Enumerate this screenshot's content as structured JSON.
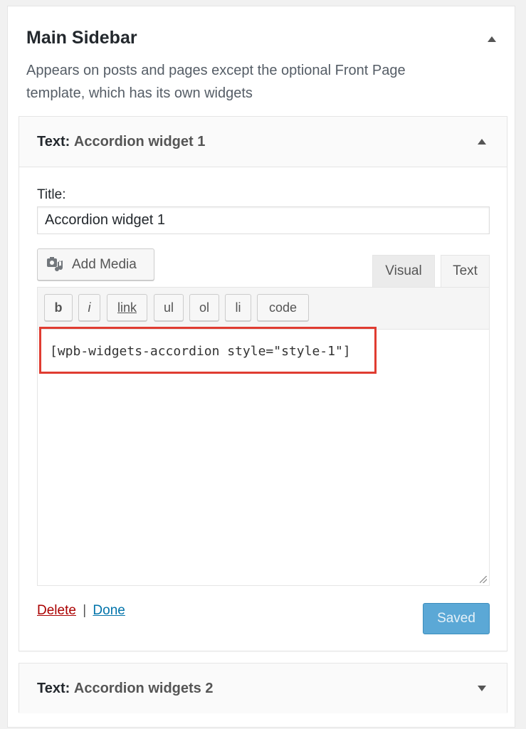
{
  "sidebar": {
    "title": "Main Sidebar",
    "description": "Appears on posts and pages except the optional Front Page template, which has its own widgets"
  },
  "widget1": {
    "type_label": "Text:",
    "name": "Accordion widget 1",
    "form": {
      "title_label": "Title:",
      "title_value": "Accordion widget 1",
      "add_media_label": "Add Media",
      "tabs": {
        "visual": "Visual",
        "text": "Text"
      },
      "quicktags": [
        "b",
        "i",
        "link",
        "ul",
        "ol",
        "li",
        "code"
      ],
      "content": "[wpb-widgets-accordion style=\"style-1\"]",
      "delete_label": "Delete",
      "separator": "|",
      "done_label": "Done",
      "save_label": "Saved"
    }
  },
  "widget2": {
    "type_label": "Text:",
    "name": "Accordion widgets 2"
  },
  "colors": {
    "highlight": "#e03c31",
    "primary_button": "#5ba8d6",
    "link": "#0073aa",
    "delete": "#aa0000"
  }
}
